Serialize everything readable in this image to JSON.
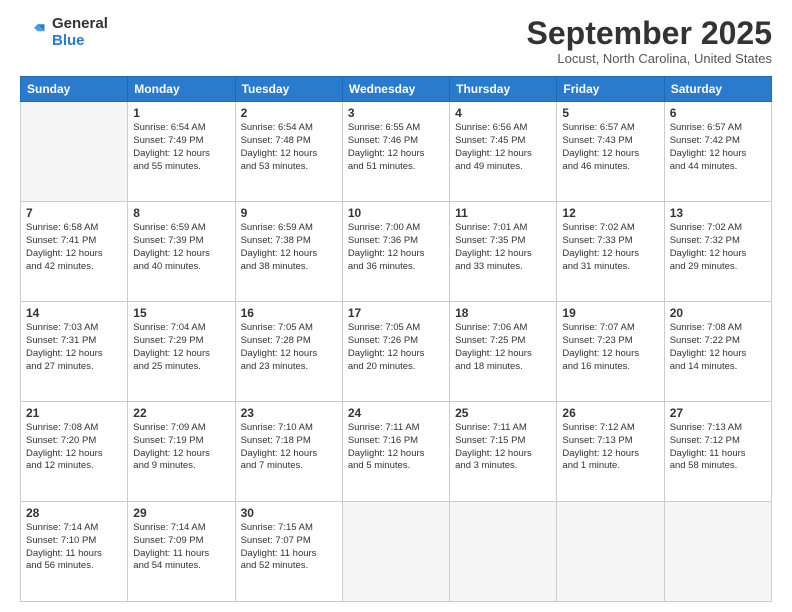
{
  "logo": {
    "general": "General",
    "blue": "Blue"
  },
  "header": {
    "title": "September 2025",
    "location": "Locust, North Carolina, United States"
  },
  "weekdays": [
    "Sunday",
    "Monday",
    "Tuesday",
    "Wednesday",
    "Thursday",
    "Friday",
    "Saturday"
  ],
  "weeks": [
    [
      {
        "day": "",
        "info": ""
      },
      {
        "day": "1",
        "info": "Sunrise: 6:54 AM\nSunset: 7:49 PM\nDaylight: 12 hours\nand 55 minutes."
      },
      {
        "day": "2",
        "info": "Sunrise: 6:54 AM\nSunset: 7:48 PM\nDaylight: 12 hours\nand 53 minutes."
      },
      {
        "day": "3",
        "info": "Sunrise: 6:55 AM\nSunset: 7:46 PM\nDaylight: 12 hours\nand 51 minutes."
      },
      {
        "day": "4",
        "info": "Sunrise: 6:56 AM\nSunset: 7:45 PM\nDaylight: 12 hours\nand 49 minutes."
      },
      {
        "day": "5",
        "info": "Sunrise: 6:57 AM\nSunset: 7:43 PM\nDaylight: 12 hours\nand 46 minutes."
      },
      {
        "day": "6",
        "info": "Sunrise: 6:57 AM\nSunset: 7:42 PM\nDaylight: 12 hours\nand 44 minutes."
      }
    ],
    [
      {
        "day": "7",
        "info": "Sunrise: 6:58 AM\nSunset: 7:41 PM\nDaylight: 12 hours\nand 42 minutes."
      },
      {
        "day": "8",
        "info": "Sunrise: 6:59 AM\nSunset: 7:39 PM\nDaylight: 12 hours\nand 40 minutes."
      },
      {
        "day": "9",
        "info": "Sunrise: 6:59 AM\nSunset: 7:38 PM\nDaylight: 12 hours\nand 38 minutes."
      },
      {
        "day": "10",
        "info": "Sunrise: 7:00 AM\nSunset: 7:36 PM\nDaylight: 12 hours\nand 36 minutes."
      },
      {
        "day": "11",
        "info": "Sunrise: 7:01 AM\nSunset: 7:35 PM\nDaylight: 12 hours\nand 33 minutes."
      },
      {
        "day": "12",
        "info": "Sunrise: 7:02 AM\nSunset: 7:33 PM\nDaylight: 12 hours\nand 31 minutes."
      },
      {
        "day": "13",
        "info": "Sunrise: 7:02 AM\nSunset: 7:32 PM\nDaylight: 12 hours\nand 29 minutes."
      }
    ],
    [
      {
        "day": "14",
        "info": "Sunrise: 7:03 AM\nSunset: 7:31 PM\nDaylight: 12 hours\nand 27 minutes."
      },
      {
        "day": "15",
        "info": "Sunrise: 7:04 AM\nSunset: 7:29 PM\nDaylight: 12 hours\nand 25 minutes."
      },
      {
        "day": "16",
        "info": "Sunrise: 7:05 AM\nSunset: 7:28 PM\nDaylight: 12 hours\nand 23 minutes."
      },
      {
        "day": "17",
        "info": "Sunrise: 7:05 AM\nSunset: 7:26 PM\nDaylight: 12 hours\nand 20 minutes."
      },
      {
        "day": "18",
        "info": "Sunrise: 7:06 AM\nSunset: 7:25 PM\nDaylight: 12 hours\nand 18 minutes."
      },
      {
        "day": "19",
        "info": "Sunrise: 7:07 AM\nSunset: 7:23 PM\nDaylight: 12 hours\nand 16 minutes."
      },
      {
        "day": "20",
        "info": "Sunrise: 7:08 AM\nSunset: 7:22 PM\nDaylight: 12 hours\nand 14 minutes."
      }
    ],
    [
      {
        "day": "21",
        "info": "Sunrise: 7:08 AM\nSunset: 7:20 PM\nDaylight: 12 hours\nand 12 minutes."
      },
      {
        "day": "22",
        "info": "Sunrise: 7:09 AM\nSunset: 7:19 PM\nDaylight: 12 hours\nand 9 minutes."
      },
      {
        "day": "23",
        "info": "Sunrise: 7:10 AM\nSunset: 7:18 PM\nDaylight: 12 hours\nand 7 minutes."
      },
      {
        "day": "24",
        "info": "Sunrise: 7:11 AM\nSunset: 7:16 PM\nDaylight: 12 hours\nand 5 minutes."
      },
      {
        "day": "25",
        "info": "Sunrise: 7:11 AM\nSunset: 7:15 PM\nDaylight: 12 hours\nand 3 minutes."
      },
      {
        "day": "26",
        "info": "Sunrise: 7:12 AM\nSunset: 7:13 PM\nDaylight: 12 hours\nand 1 minute."
      },
      {
        "day": "27",
        "info": "Sunrise: 7:13 AM\nSunset: 7:12 PM\nDaylight: 11 hours\nand 58 minutes."
      }
    ],
    [
      {
        "day": "28",
        "info": "Sunrise: 7:14 AM\nSunset: 7:10 PM\nDaylight: 11 hours\nand 56 minutes."
      },
      {
        "day": "29",
        "info": "Sunrise: 7:14 AM\nSunset: 7:09 PM\nDaylight: 11 hours\nand 54 minutes."
      },
      {
        "day": "30",
        "info": "Sunrise: 7:15 AM\nSunset: 7:07 PM\nDaylight: 11 hours\nand 52 minutes."
      },
      {
        "day": "",
        "info": ""
      },
      {
        "day": "",
        "info": ""
      },
      {
        "day": "",
        "info": ""
      },
      {
        "day": "",
        "info": ""
      }
    ]
  ]
}
